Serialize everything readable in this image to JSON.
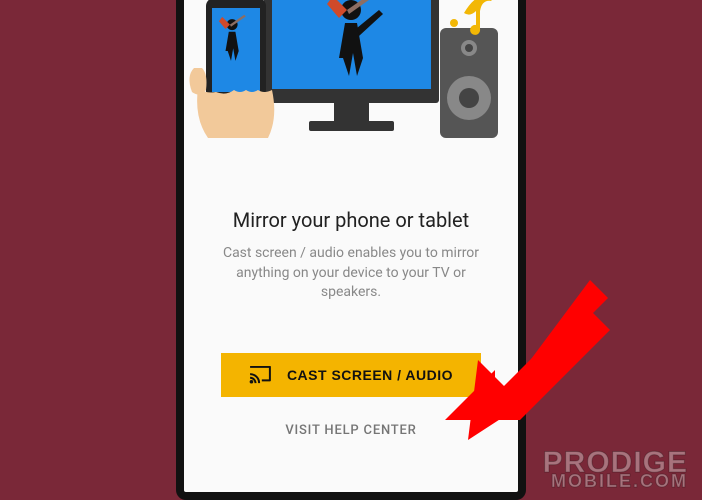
{
  "title": "Mirror your phone or tablet",
  "subtitle": "Cast screen / audio enables you to mirror anything on your device to your TV or speakers.",
  "cast_button_label": "CAST SCREEN / AUDIO",
  "help_link_label": "VISIT HELP CENTER",
  "watermark": {
    "line1": "PRODIGE",
    "line2": "MOBILE.COM"
  },
  "colors": {
    "background": "#7a2838",
    "screen_bg": "#fafafa",
    "title_text": "#212121",
    "subtitle_text": "#888888",
    "button_bg": "#f4b400",
    "button_text": "#111111",
    "help_text": "#757575",
    "arrow": "#ff0000",
    "illustration_blue": "#1e88e5",
    "illustration_dark": "#333333"
  }
}
